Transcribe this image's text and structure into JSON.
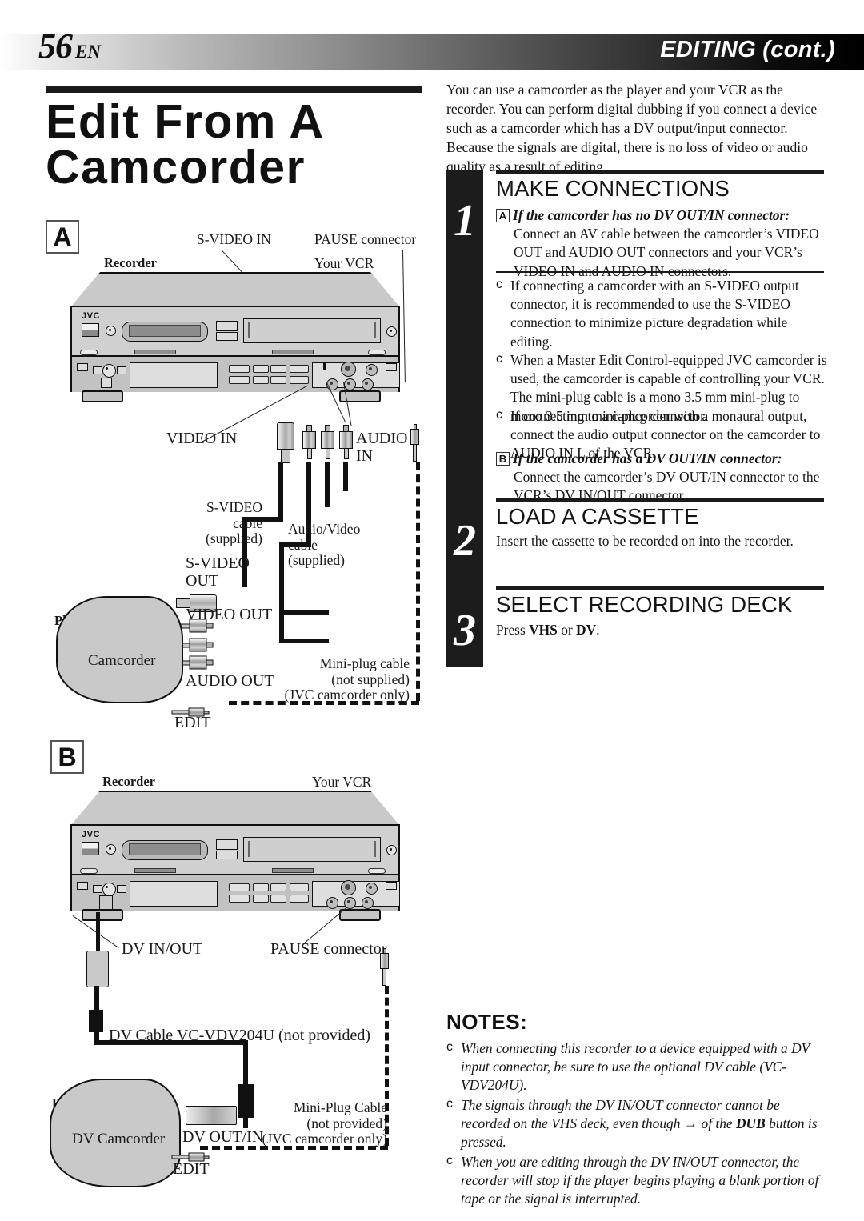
{
  "header": {
    "page_number": "56",
    "page_lang": "EN",
    "chapter_title": "EDITING (cont.)"
  },
  "left": {
    "title": "Edit From A Camcorder",
    "title_line1": "Edit From A",
    "title_line2": "Camcorder",
    "diagram_a": {
      "badge": "A",
      "labels": {
        "recorder": "Recorder",
        "your_vcr": "Your VCR",
        "s_video_in": "S-VIDEO IN",
        "pause_connector": "PAUSE connector",
        "video_in": "VIDEO IN",
        "audio_in": "AUDIO IN",
        "audio_in_l1": "AUDIO",
        "audio_in_l2": "IN",
        "jvc_logo": "JVC",
        "s_video_cable": "S-VIDEO cable (supplied)",
        "s_video_cable_l1": "S-VIDEO",
        "s_video_cable_l2": "cable",
        "s_video_cable_l3": "(supplied)",
        "av_cable_l1": "Audio/Video",
        "av_cable_l2": "cable",
        "av_cable_l3": "(supplied)",
        "s_video_out_l1": "S-VIDEO",
        "s_video_out_l2": "OUT",
        "video_out": "VIDEO OUT",
        "audio_out": "AUDIO OUT",
        "player": "Player",
        "camcorder": "Camcorder",
        "edit": "EDIT",
        "mini_plug_l1": "Mini-plug cable",
        "mini_plug_l2": "(not supplied)",
        "mini_plug_l3": "(JVC camcorder only)"
      }
    },
    "diagram_b": {
      "badge": "B",
      "labels": {
        "recorder": "Recorder",
        "your_vcr": "Your VCR",
        "jvc_logo": "JVC",
        "dv_in_out": "DV IN/OUT",
        "pause_connector": "PAUSE connector",
        "dv_cable": "DV Cable VC-VDV204U (not provided)",
        "player": "Player",
        "dv_camcorder": "DV Camcorder",
        "dv_out_in": "DV OUT/IN",
        "edit": "EDIT",
        "mini_plug_l1": "Mini-Plug Cable",
        "mini_plug_l2": "(not provided)",
        "mini_plug_l3": "(JVC camcorder only)"
      }
    }
  },
  "right": {
    "intro": "You can use a camcorder as the player and your VCR as the recorder. You can perform digital dubbing if you connect a device such as a camcorder which has a DV output/input connector. Because the signals are digital, there is no loss of video or audio quality as a result of editing.",
    "steps": [
      {
        "number": "1",
        "title": "MAKE CONNECTIONS",
        "sub_badge_a": "A",
        "sub_a_heading": "If the camcorder has no DV OUT/IN connector:",
        "sub_a_body": "Connect an AV cable between the camcorder’s VIDEO OUT and AUDIO OUT connectors and your VCR’s VIDEO IN and AUDIO IN connectors.",
        "bullets": [
          "If connecting a camcorder with an S-VIDEO output connector, it is recommended to use the S-VIDEO connection to minimize picture degradation while editing.",
          "When a Master Edit Control-equipped JVC camcorder is used, the camcorder is capable of controlling your VCR. The mini-plug cable is a mono 3.5 mm mini-plug to mono 3.5 mm mini-plug connector.",
          "If connecting to a camcorder with a monaural output, connect the audio output connector on the camcorder to AUDIO IN L of the VCR."
        ],
        "sub_badge_b": "B",
        "sub_b_heading": "If the camcorder has a DV OUT/IN connector:",
        "sub_b_body": "Connect the camcorder’s DV OUT/IN connector to the VCR’s DV IN/OUT connector."
      },
      {
        "number": "2",
        "title": "LOAD A CASSETTE",
        "body": "Insert the cassette to be recorded on into the recorder."
      },
      {
        "number": "3",
        "title": "SELECT RECORDING DECK",
        "body_pre": "Press ",
        "body_key1": "VHS",
        "body_mid": " or ",
        "body_key2": "DV",
        "body_post": "."
      }
    ],
    "notes": {
      "heading": "NOTES:",
      "items": [
        "When connecting this recorder to a device equipped with a DV input connector, be sure to use the optional DV cable (VC-VDV204U).",
        "The signals through the DV IN/OUT connector cannot be recorded on the VHS deck, even though → of the DUB button is pressed.",
        "When you are editing through the DV IN/OUT connector, the recorder will stop if the player begins playing a blank portion of tape or the signal is interrupted."
      ],
      "item2_pre": "The signals through the DV IN/OUT connector cannot be recorded on the VHS deck, even though → of the ",
      "item2_bold": "DUB",
      "item2_post": " button is pressed."
    },
    "bullet_glyph": "c"
  },
  "colors": {
    "ink": "#111111",
    "panel_gray": "#c9c9c9",
    "bar_black": "#1c1c1c"
  }
}
